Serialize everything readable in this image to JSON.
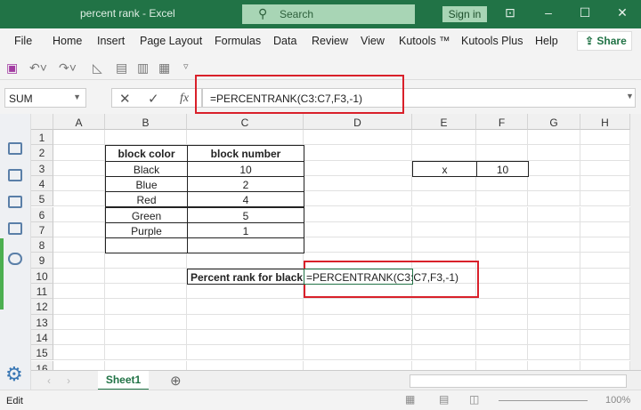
{
  "window": {
    "title": "percent rank  -  Excel",
    "search_placeholder": "Search",
    "sign_in": "Sign in",
    "accent": "#217346"
  },
  "ribbon": {
    "tabs": [
      "File",
      "Home",
      "Insert",
      "Page Layout",
      "Formulas",
      "Data",
      "Review",
      "View",
      "Kutools ™",
      "Kutools Plus",
      "Help"
    ],
    "share": "Share"
  },
  "formula_bar": {
    "name_box": "SUM",
    "formula": "=PERCENTRANK(C3:C7,F3,-1)",
    "fx": "fx",
    "cancel": "✕",
    "enter": "✓"
  },
  "columns": [
    "A",
    "B",
    "C",
    "D",
    "E",
    "F",
    "G",
    "H"
  ],
  "rows": [
    "1",
    "2",
    "3",
    "4",
    "5",
    "6",
    "7",
    "8",
    "9",
    "10",
    "11",
    "12",
    "13",
    "14",
    "15",
    "16"
  ],
  "table": {
    "headers": [
      "block color",
      "block number"
    ],
    "rows": [
      [
        "Black",
        "10"
      ],
      [
        "Blue",
        "2"
      ],
      [
        "Red",
        "4"
      ],
      [
        "Green",
        "5"
      ],
      [
        "Purple",
        "1"
      ]
    ]
  },
  "x_cell": {
    "label": "x",
    "value": "10"
  },
  "result": {
    "label": "Percent rank for black",
    "formula": "=PERCENTRANK(C3:C7,F3,-1)"
  },
  "sheets": [
    "Sheet1"
  ],
  "status": {
    "mode": "Edit",
    "zoom": "100%"
  }
}
